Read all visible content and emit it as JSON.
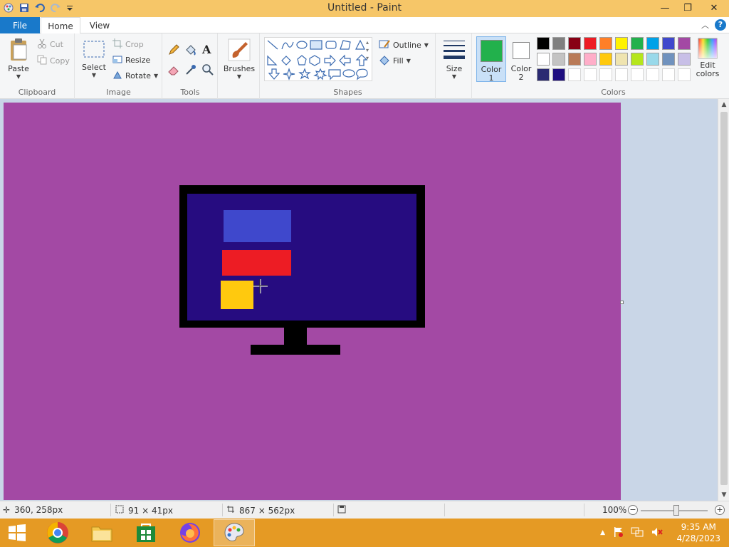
{
  "window": {
    "title": "Untitled - Paint",
    "controls": {
      "minimize": "—",
      "restore": "❐",
      "close": "✕"
    }
  },
  "tabs": {
    "file": "File",
    "home": "Home",
    "view": "View"
  },
  "ribbon": {
    "clipboard": {
      "label": "Clipboard",
      "paste": "Paste",
      "cut": "Cut",
      "copy": "Copy"
    },
    "image": {
      "label": "Image",
      "select": "Select",
      "crop": "Crop",
      "resize": "Resize",
      "rotate": "Rotate"
    },
    "tools": {
      "label": "Tools"
    },
    "brushes": {
      "label": "Brushes"
    },
    "shapes": {
      "label": "Shapes",
      "outline": "Outline",
      "fill": "Fill"
    },
    "size": {
      "label": "Size"
    },
    "color1": {
      "label": "Color",
      "num": "1"
    },
    "color2": {
      "label": "Color",
      "num": "2"
    },
    "colors": {
      "label": "Colors",
      "edit_line1": "Edit",
      "edit_line2": "colors"
    }
  },
  "colors": {
    "color1_value": "#22b14c",
    "color2_value": "#ffffff",
    "palette_row1": [
      "#000000",
      "#7f7f7f",
      "#880015",
      "#ed1c24",
      "#ff7f27",
      "#fff200",
      "#22b14c",
      "#00a2e8",
      "#3f48cc",
      "#a349a4"
    ],
    "palette_row2": [
      "#ffffff",
      "#c3c3c3",
      "#b97a57",
      "#ffaec9",
      "#ffc90e",
      "#efe4b0",
      "#b5e61d",
      "#99d9ea",
      "#7092be",
      "#c8bfe7"
    ],
    "palette_row3": [
      "#2a2a72",
      "#1f0f80",
      "#ffffff",
      "#ffffff",
      "#ffffff",
      "#ffffff",
      "#ffffff",
      "#ffffff",
      "#ffffff",
      "#ffffff"
    ]
  },
  "canvas": {
    "background": "#a349a4",
    "monitor_frame": "#000000",
    "screen_fill": "#260c80",
    "blue_rect": "#3f48cc",
    "red_rect": "#ed1c24",
    "yellow_rect": "#ffc90e"
  },
  "status": {
    "cursor_pos": "360, 258px",
    "selection_size": "91 × 41px",
    "image_size": "867 × 562px",
    "zoom": "100%"
  },
  "taskbar": {
    "time": "9:35 AM",
    "date": "4/28/2023"
  }
}
